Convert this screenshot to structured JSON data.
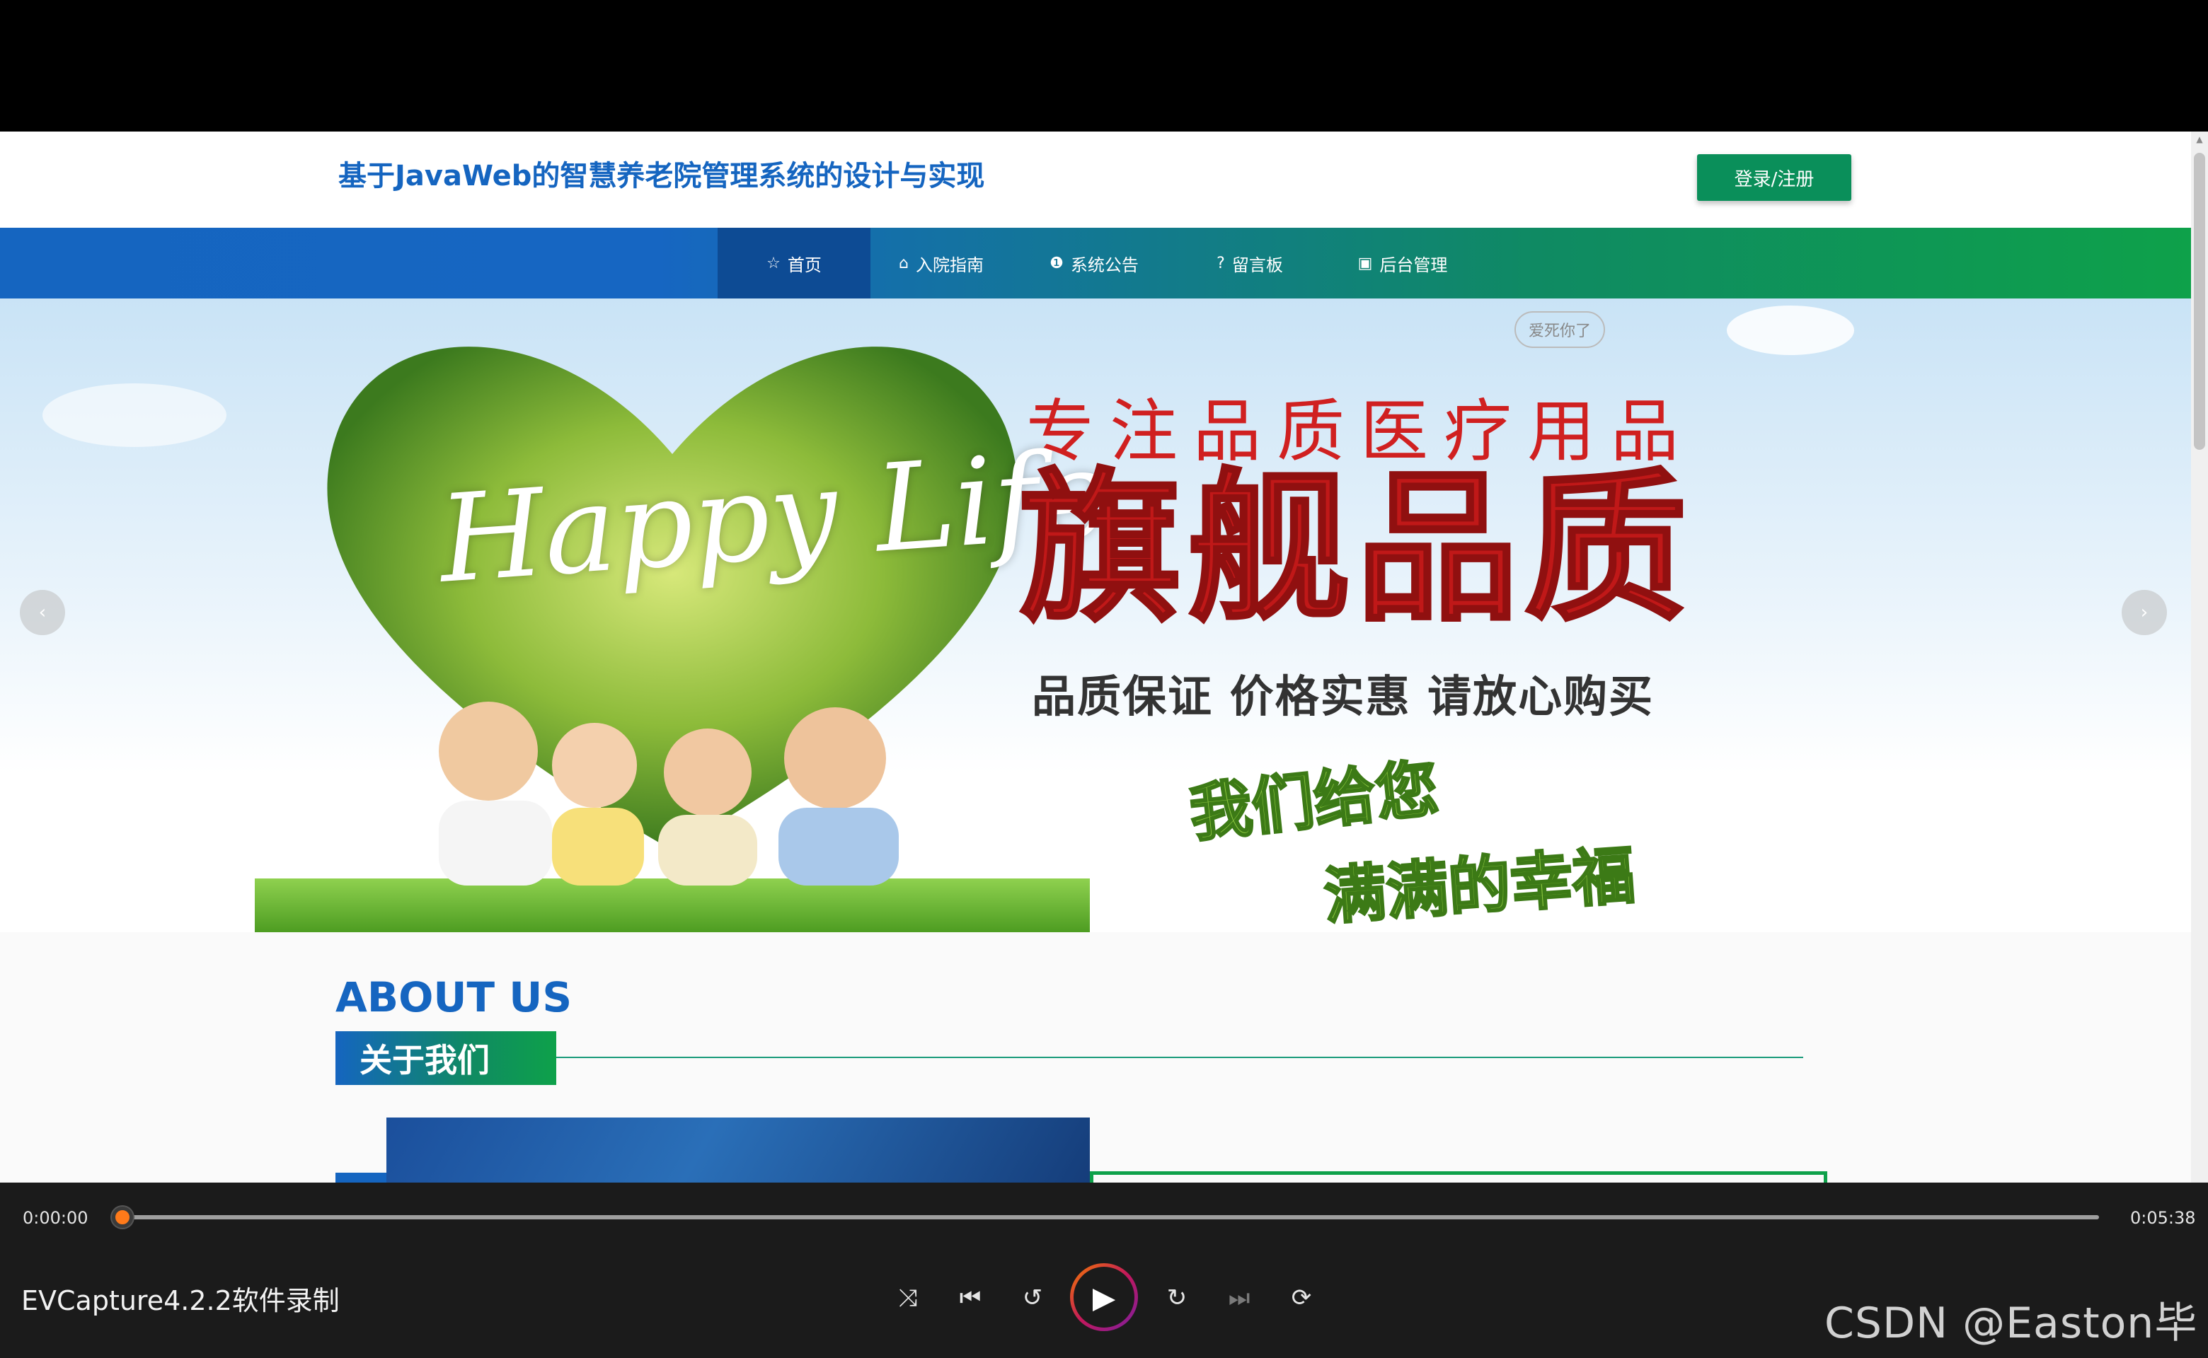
{
  "page": {
    "title": "基于JavaWeb的智慧养老院管理系统的设计与实现",
    "login_label": "登录/注册"
  },
  "nav": {
    "items": [
      {
        "label": "首页",
        "icon": "star-icon",
        "active": true
      },
      {
        "label": "入院指南",
        "icon": "bag-icon",
        "active": false
      },
      {
        "label": "系统公告",
        "icon": "info-icon",
        "active": false
      },
      {
        "label": "留言板",
        "icon": "help-icon",
        "active": false
      },
      {
        "label": "后台管理",
        "icon": "box-icon",
        "active": false
      }
    ]
  },
  "banner": {
    "happy_life": "Happy Life",
    "love_tag": "爱死你了",
    "slogan_top": "专注品质医疗用品",
    "slogan_main": "旗舰品质",
    "slogan_sub": "品质保证  价格实惠  请放心购买",
    "slogan_wish_1": "我们给您",
    "slogan_wish_2": "满满的幸福",
    "prev_icon": "chevron-left-icon",
    "next_icon": "chevron-right-icon"
  },
  "about": {
    "title_en": "ABOUT US",
    "title_zh": "关于我们"
  },
  "player": {
    "current_time": "0:00:00",
    "total_time": "0:05:38",
    "progress": 0.0,
    "media_title": "EVCapture4.2.2软件录制",
    "controls": [
      "shuffle-icon",
      "previous-icon",
      "rewind-10-icon",
      "play-icon",
      "forward-30-icon",
      "next-icon",
      "repeat-icon"
    ]
  },
  "watermark": "CSDN @Easton毕设",
  "colors": {
    "brand_blue": "#1565c0",
    "brand_green": "#0ea14a",
    "login_green": "#0a8f5a",
    "slogan_red": "#c01818",
    "player_accent": "#ff7a1a"
  }
}
